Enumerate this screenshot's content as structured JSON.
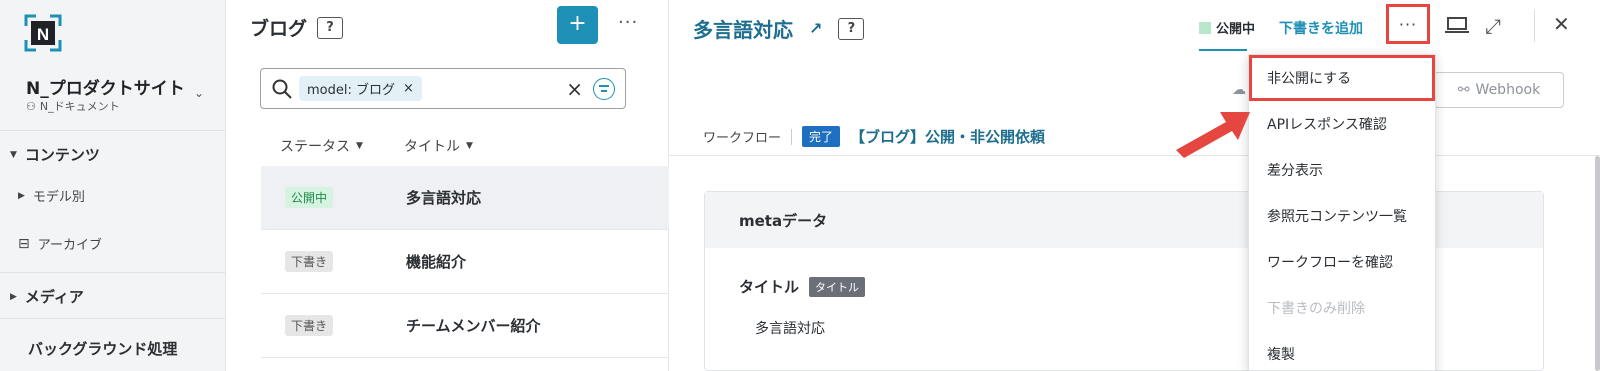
{
  "sidebar": {
    "service_name": "N_プロダクトサイト",
    "service_sub": "N_ドキュメント",
    "items": [
      {
        "label": "コンテンツ"
      },
      {
        "label": "モデル別"
      },
      {
        "label": "アーカイブ"
      },
      {
        "label": "メディア"
      },
      {
        "label": "バックグラウンド処理"
      }
    ]
  },
  "list": {
    "title": "ブログ",
    "help": "?",
    "add_label": "+",
    "more_label": "···",
    "search_chip": "model: ブログ",
    "chip_remove": "×",
    "search_clear": "×",
    "columns": [
      {
        "label": "ステータス"
      },
      {
        "label": "タイトル"
      }
    ],
    "rows": [
      {
        "status": "公開中",
        "title": "多言語対応"
      },
      {
        "status": "下書き",
        "title": "機能紹介"
      },
      {
        "status": "下書き",
        "title": "チームメンバー紹介"
      }
    ]
  },
  "detail": {
    "title": "多言語対応",
    "ext_arrow": "↗",
    "help": "?",
    "status_tab": "公開中",
    "add_draft": "下書きを追加",
    "more_label": "···",
    "expand": "⤢",
    "close": "✕",
    "webhook_label": "Webhook",
    "workflow_label": "ワークフロー",
    "workflow_badge": "完了",
    "workflow_link": "【ブログ】公開・非公開依頼",
    "meta_header": "metaデータ",
    "field_label": "タイトル",
    "field_tag": "タイトル",
    "field_value": "多言語対応"
  },
  "menu": {
    "items": [
      {
        "label": "非公開にする"
      },
      {
        "label": "APIレスポンス確認"
      },
      {
        "label": "差分表示"
      },
      {
        "label": "参照元コンテンツ一覧"
      },
      {
        "label": "ワークフローを確認"
      },
      {
        "label": "下書きのみ削除"
      },
      {
        "label": "複製"
      }
    ]
  },
  "colors": {
    "accent": "#1e90b6",
    "highlight": "#e5463f",
    "published": "#d6f2e0",
    "done": "#1e6fbf"
  }
}
